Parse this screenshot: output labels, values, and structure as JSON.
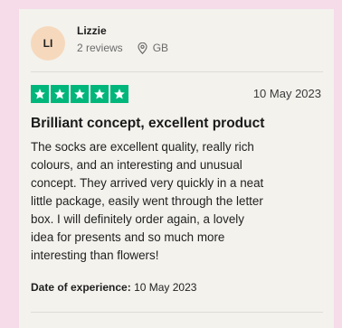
{
  "review": {
    "avatar_initials": "LI",
    "reviewer_name": "Lizzie",
    "reviews_count": "2 reviews",
    "location": "GB",
    "location_icon": "map-pin-icon",
    "rating_stars": 5,
    "rating_color": "#00b67a",
    "date": "10 May 2023",
    "title": "Brilliant concept, excellent product",
    "body_lines": [
      "The socks are excellent quality, really rich",
      "colours, and an interesting and unusual",
      "concept. They arrived very quickly in a neat",
      "little package, easily went through the letter",
      "box. I will definitely order again, a lovely",
      "idea for presents and so much more",
      "interesting than flowers!"
    ],
    "experience_label": "Date of experience:",
    "experience_date": "10 May 2023"
  }
}
